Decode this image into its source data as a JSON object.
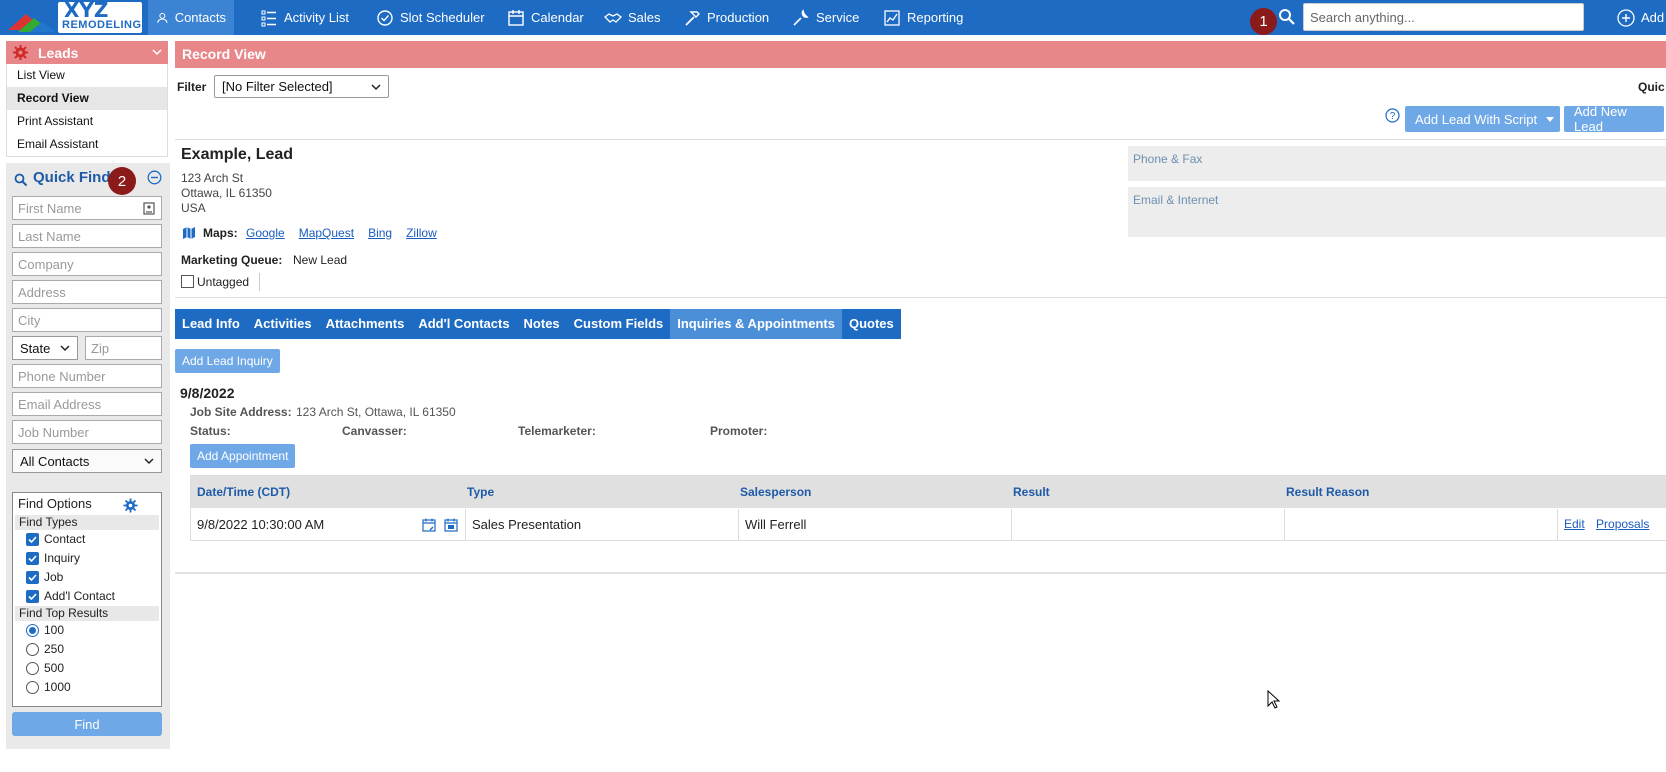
{
  "brand": {
    "logo_line1": "XYZ",
    "logo_line2": "REMODELING",
    "accent": "#1e6bc4",
    "header_color": "#e8878a"
  },
  "nav": {
    "items": [
      {
        "label": "Contacts",
        "icon": "person-icon"
      },
      {
        "label": "Activity List",
        "icon": "list-icon"
      },
      {
        "label": "Slot Scheduler",
        "icon": "check-circle-icon"
      },
      {
        "label": "Calendar",
        "icon": "calendar-icon"
      },
      {
        "label": "Sales",
        "icon": "handshake-icon"
      },
      {
        "label": "Production",
        "icon": "hammer-icon"
      },
      {
        "label": "Service",
        "icon": "wrench-icon"
      },
      {
        "label": "Reporting",
        "icon": "chart-icon"
      }
    ],
    "search_placeholder": "Search anything...",
    "add_label": "Add",
    "badge1": "1",
    "badge2": "2"
  },
  "leads": {
    "title": "Leads",
    "menu": [
      "List View",
      "Record View",
      "Print Assistant",
      "Email Assistant"
    ],
    "selected": "Record View"
  },
  "quick_find": {
    "title": "Quick Find",
    "placeholders": {
      "first_name": "First Name",
      "last_name": "Last Name",
      "company": "Company",
      "address": "Address",
      "city": "City",
      "zip": "Zip",
      "phone": "Phone Number",
      "email": "Email Address",
      "job_number": "Job Number"
    },
    "state_label": "State",
    "contacts_filter": "All Contacts",
    "find_options_label": "Find Options",
    "find_types_label": "Find Types",
    "find_types": [
      "Contact",
      "Inquiry",
      "Job",
      "Add'l Contact"
    ],
    "top_results_label": "Find Top Results",
    "top_results": [
      "100",
      "250",
      "500",
      "1000"
    ],
    "top_results_selected": "100",
    "find_button": "Find"
  },
  "record_view": {
    "title": "Record View",
    "filter_label": "Filter",
    "filter_value": "[No Filter Selected]",
    "quick_label": "Quic",
    "add_lead_script": "Add Lead With Script",
    "add_new_lead": "Add New Lead"
  },
  "lead": {
    "name": "Example, Lead",
    "address1": "123 Arch St",
    "address2": "Ottawa, IL 61350",
    "country": "USA",
    "maps_label": "Maps:",
    "maps_links": [
      "Google",
      "MapQuest",
      "Bing",
      "Zillow"
    ],
    "marketing_queue_label": "Marketing Queue:",
    "marketing_queue_value": "New Lead",
    "tag_label": "Untagged",
    "phone_fax_label": "Phone & Fax",
    "email_internet_label": "Email & Internet"
  },
  "tabs": [
    "Lead Info",
    "Activities",
    "Attachments",
    "Add'l Contacts",
    "Notes",
    "Custom Fields",
    "Inquiries & Appointments",
    "Quotes"
  ],
  "active_tab": "Inquiries & Appointments",
  "inquiry": {
    "add_button": "Add Lead Inquiry",
    "date": "9/8/2022",
    "job_site_label": "Job Site Address:",
    "job_site_value": "123 Arch St, Ottawa, IL 61350",
    "status_label": "Status:",
    "canvasser_label": "Canvasser:",
    "telemarketer_label": "Telemarketer:",
    "promoter_label": "Promoter:",
    "add_appointment": "Add Appointment"
  },
  "appointments": {
    "headers": [
      "Date/Time (CDT)",
      "Type",
      "Salesperson",
      "Result",
      "Result Reason"
    ],
    "rows": [
      {
        "datetime": "9/8/2022 10:30:00 AM",
        "type": "Sales Presentation",
        "salesperson": "Will Ferrell",
        "result": "",
        "reason": "",
        "edit": "Edit",
        "proposals": "Proposals"
      }
    ]
  }
}
